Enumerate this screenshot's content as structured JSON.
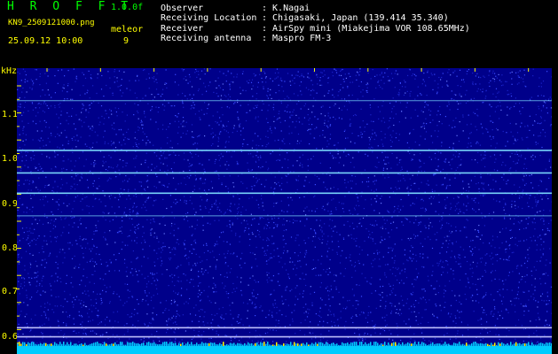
{
  "header": {
    "logo": "H R O F F T",
    "version": "1.0.0f",
    "filename": "KN9_2509121000.png",
    "datetime": "25.09.12 10:00",
    "mode_label": "meleor",
    "count": "9",
    "info": [
      {
        "key": "Observer",
        "value": ": K.Nagai"
      },
      {
        "key": "Receiving Location",
        "value": ": Chigasaki, Japan (139.414 35.340)"
      },
      {
        "key": "Receiver",
        "value": ": AirSpy mini (Miakejima VOR 108.65MHz)"
      },
      {
        "key": "Receiving antenna",
        "value": ": Maspro FM-3"
      }
    ]
  },
  "axis": {
    "unit": "kHz",
    "y_ticks": [
      "1.1",
      "1.0",
      "0.9",
      "0.8",
      "0.7",
      "0.6"
    ],
    "x_ticks": [
      "1001",
      "1002",
      "1003",
      "1004",
      "1005",
      "1006",
      "1007",
      "1008",
      "1009",
      "1010"
    ]
  },
  "colors": {
    "background": "#00008a",
    "noise": "#3a4cff",
    "carrier": "#7fe0ff",
    "axis_text": "#ffff00",
    "header_green": "#00ff00",
    "baseline": "#00ccff"
  },
  "spectrogram": {
    "carrier_lines_khz": [
      1.12,
      1.01,
      0.96,
      0.915,
      0.865,
      0.617,
      0.597
    ],
    "y_range_khz": [
      0.58,
      1.18
    ]
  }
}
